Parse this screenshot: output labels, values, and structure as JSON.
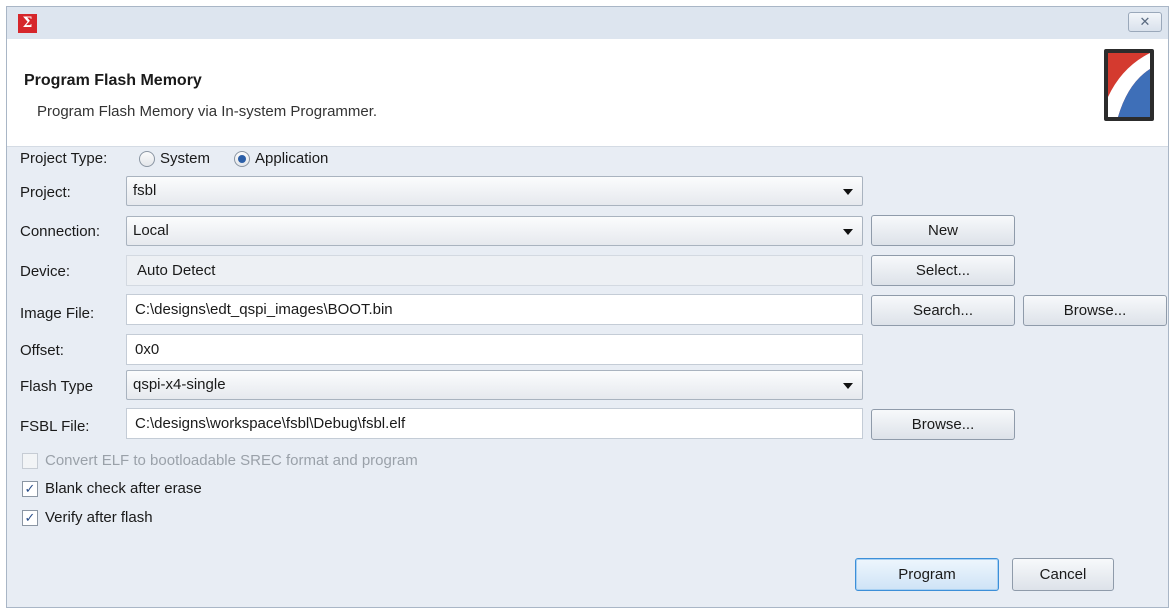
{
  "header": {
    "title": "Program Flash Memory",
    "description": "Program Flash Memory via In-system Programmer."
  },
  "titlebar": {
    "close_glyph": "✕",
    "app_icon_glyph": "Σ"
  },
  "project_type": {
    "label": "Project Type:",
    "options": [
      "System",
      "Application"
    ],
    "selected": "Application"
  },
  "project": {
    "label": "Project:",
    "value": "fsbl"
  },
  "connection": {
    "label": "Connection:",
    "value": "Local",
    "new_label": "New"
  },
  "device": {
    "label": "Device:",
    "value": "Auto Detect",
    "select_label": "Select..."
  },
  "image_file": {
    "label": "Image File:",
    "value": "C:\\designs\\edt_qspi_images\\BOOT.bin",
    "search_label": "Search...",
    "browse_label": "Browse..."
  },
  "offset": {
    "label": "Offset:",
    "value": "0x0"
  },
  "flash_type": {
    "label": "Flash Type",
    "value": "qspi-x4-single"
  },
  "fsbl_file": {
    "label": "FSBL File:",
    "value": "C:\\designs\\workspace\\fsbl\\Debug\\fsbl.elf",
    "browse_label": "Browse..."
  },
  "options": {
    "convert_elf": {
      "label": "Convert ELF to bootloadable SREC format and program",
      "checked": false,
      "enabled": false
    },
    "blank_check": {
      "label": "Blank check after erase",
      "checked": true
    },
    "verify": {
      "label": "Verify after flash",
      "checked": true
    }
  },
  "footer": {
    "program_label": "Program",
    "cancel_label": "Cancel"
  },
  "colors": {
    "accent": "#3c8fd8",
    "app_icon": "#d6262b"
  }
}
